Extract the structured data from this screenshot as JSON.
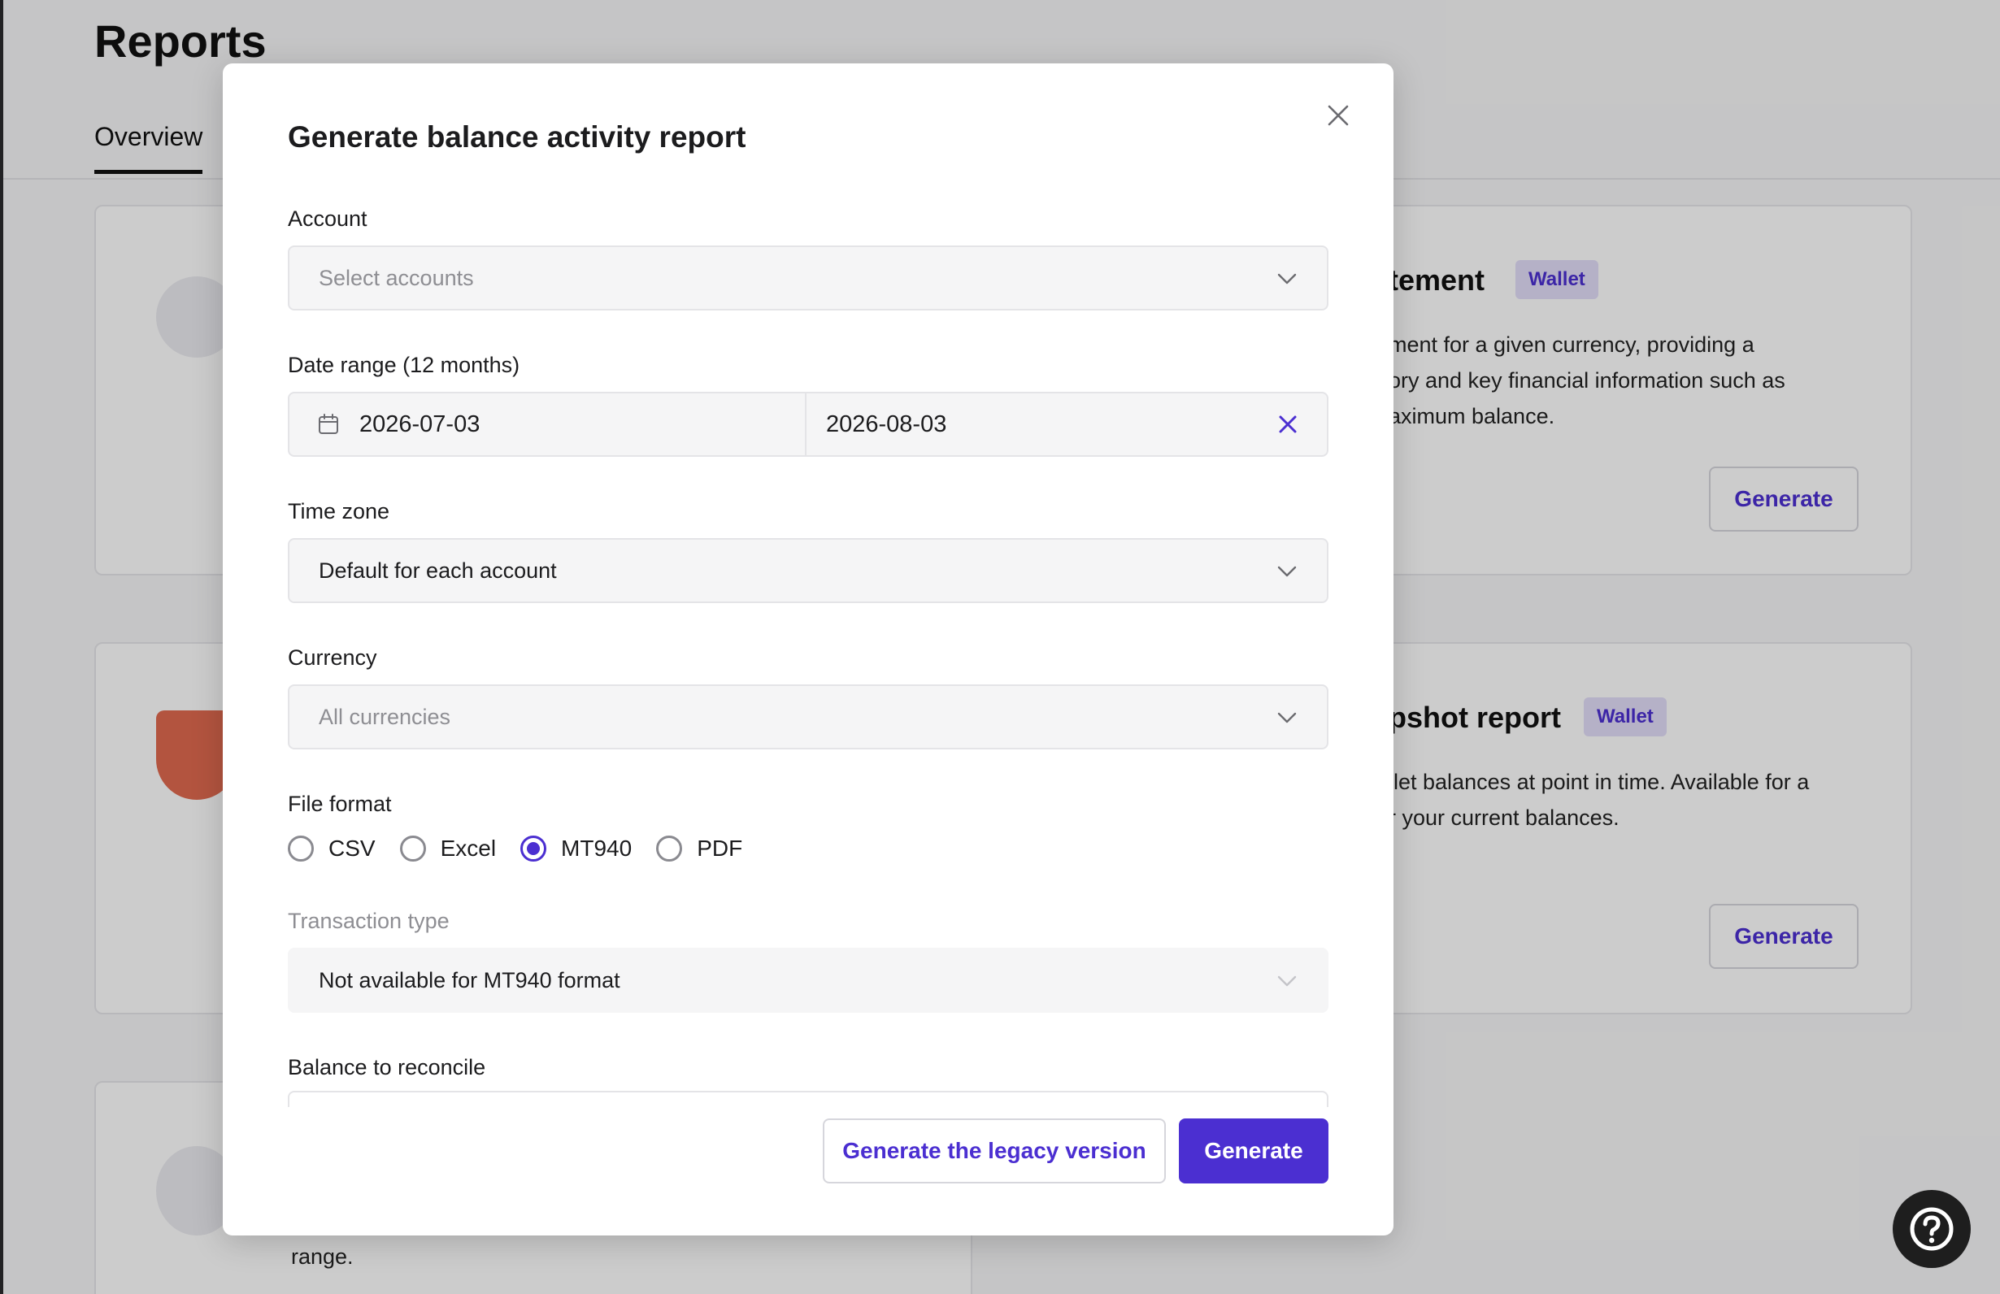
{
  "page": {
    "title": "Reports",
    "tabs": [
      {
        "label": "Overview"
      }
    ]
  },
  "cards": {
    "statement": {
      "title_fragment": "tement",
      "badge": "Wallet",
      "desc_lines": [
        "ment for a given currency, providing a",
        "ory and key financial information such as",
        "aximum balance."
      ],
      "button": "Generate"
    },
    "snapshot": {
      "title_fragment": "pshot report",
      "badge": "Wallet",
      "desc_lines": [
        "llet balances at point in time. Available for a",
        "r your current balances."
      ],
      "button": "Generate"
    },
    "third": {
      "desc_fragment": "range."
    }
  },
  "modal": {
    "title": "Generate balance activity report",
    "account": {
      "label": "Account",
      "placeholder": "Select accounts"
    },
    "date_range": {
      "label": "Date range (12 months)",
      "start": "2026-07-03",
      "end": "2026-08-03"
    },
    "time_zone": {
      "label": "Time zone",
      "value": "Default for each account"
    },
    "currency": {
      "label": "Currency",
      "placeholder": "All currencies"
    },
    "file_format": {
      "label": "File format",
      "options": [
        "CSV",
        "Excel",
        "MT940",
        "PDF"
      ],
      "selected": "MT940"
    },
    "transaction_type": {
      "label": "Transaction type",
      "value": "Not available for MT940 format"
    },
    "balance_to_reconcile": {
      "label": "Balance to reconcile"
    },
    "buttons": {
      "legacy": "Generate the legacy version",
      "generate": "Generate"
    }
  },
  "colors": {
    "accent": "#4b2fd1",
    "badge_bg": "#e3def9",
    "overlay": "rgba(0,0,0,0.2)"
  },
  "icons": [
    "close-icon",
    "chevron-down-icon",
    "calendar-icon",
    "clear-icon",
    "help-icon"
  ]
}
